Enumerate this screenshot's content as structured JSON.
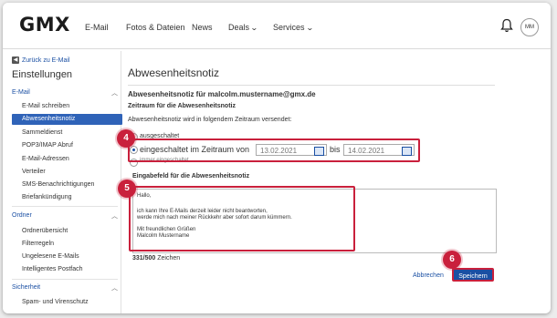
{
  "brand": {
    "logo": "GMX"
  },
  "nav": {
    "items": [
      {
        "label": "E-Mail"
      },
      {
        "label": "Fotos & Dateien"
      },
      {
        "label": "News"
      },
      {
        "label": "Deals"
      },
      {
        "label": "Services"
      }
    ],
    "avatar_initials": "MM"
  },
  "sidebar": {
    "back_label": "Zurück zu E-Mail",
    "title": "Einstellungen",
    "sections": [
      {
        "label": "E-Mail",
        "items": [
          "E-Mail schreiben",
          "Abwesenheitsnotiz",
          "Sammeldienst",
          "POP3/IMAP Abruf",
          "E-Mail-Adressen",
          "Verteiler",
          "SMS-Benachrichtigungen",
          "Briefankündigung"
        ]
      },
      {
        "label": "Ordner",
        "items": [
          "Ordnerübersicht",
          "Filterregeln",
          "Ungelesene E-Mails",
          "Intelligentes Postfach"
        ]
      },
      {
        "label": "Sicherheit",
        "items": [
          "Spam- und Virenschutz"
        ]
      }
    ],
    "active_item": "Abwesenheitsnotiz"
  },
  "main": {
    "title": "Abwesenheitsnotiz",
    "subtitle": "Abwesenheitsnotiz für malcolm.mustername@gmx.de",
    "period_heading": "Zeitraum für die Abwesenheitsnotiz",
    "period_info": "Abwesenheitsnotiz wird in folgendem Zeitraum versendet:",
    "radio_off": "ausgeschaltet",
    "radio_range": "eingeschaltet im Zeitraum von",
    "date_from": "13.02.2021",
    "between": "bis",
    "date_to": "14.02.2021",
    "radio_always": "immer eingeschaltet",
    "input_heading": "Eingabefeld für die Abwesenheitsnotiz",
    "message_lines": [
      "Hallo,",
      "",
      "ich kann Ihre E-Mails derzeit leider nicht beantworten,",
      "werde mich nach meiner Rückkehr aber sofort darum kümmern.",
      "",
      "Mit freundlichen Grüßen",
      "Malcolm Mustername"
    ],
    "char_count": "331/500",
    "char_label": "Zeichen",
    "cancel_label": "Abbrechen",
    "save_label": "Speichern"
  },
  "callouts": [
    "4",
    "5",
    "6"
  ],
  "colors": {
    "accent": "#1a4fa3",
    "highlight": "#c9203c",
    "active_bg": "#2f63b8"
  }
}
